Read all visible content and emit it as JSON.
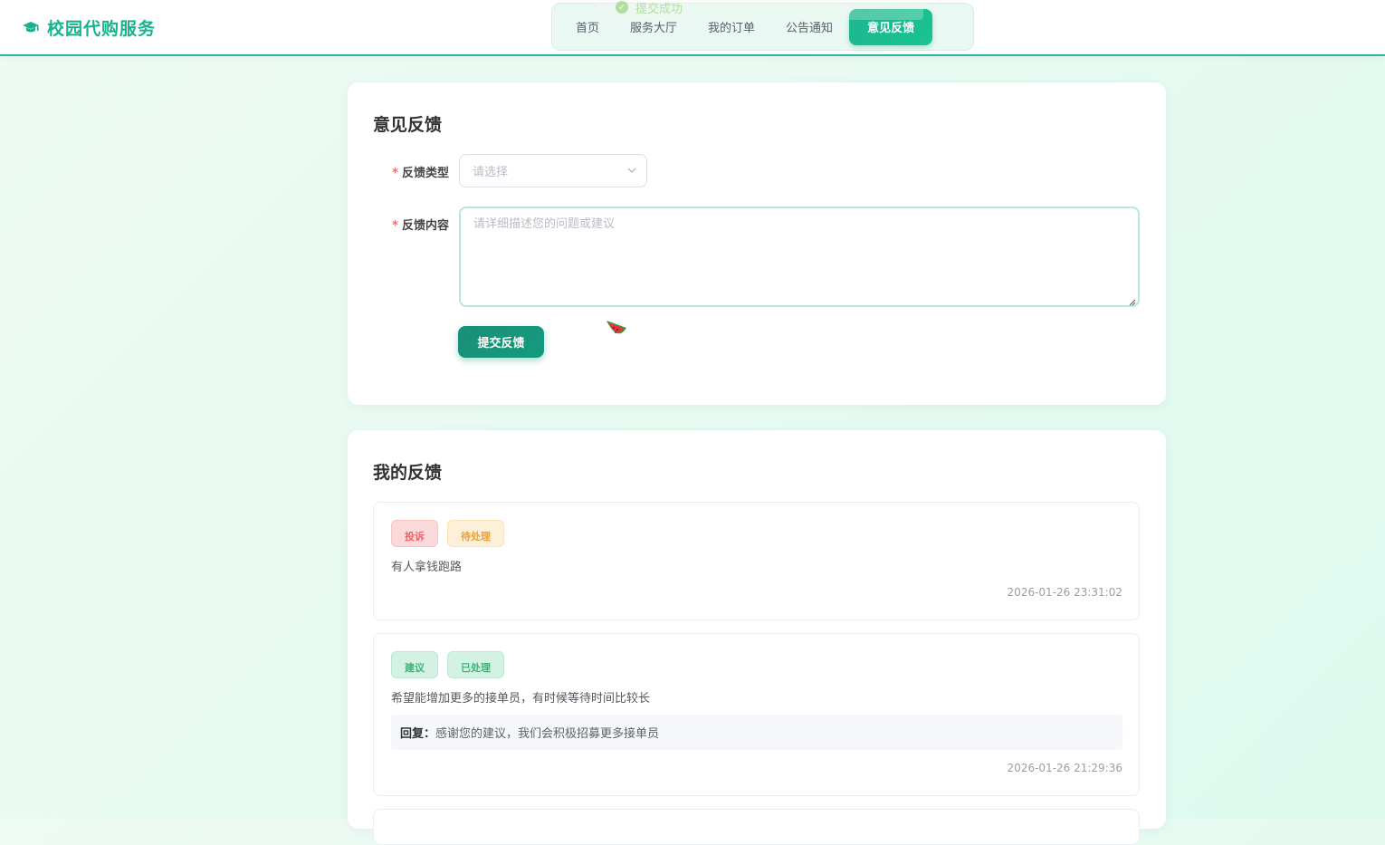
{
  "app": {
    "title": "校园代购服务",
    "accent_color": "#16b38e"
  },
  "toast": {
    "message": "提交成功"
  },
  "nav": {
    "items": [
      {
        "label": "首页"
      },
      {
        "label": "服务大厅"
      },
      {
        "label": "我的订单"
      },
      {
        "label": "公告通知"
      },
      {
        "label": "意见反馈",
        "active": true
      }
    ]
  },
  "feedback_form": {
    "title": "意见反馈",
    "type_label": "反馈类型",
    "type_placeholder": "请选择",
    "content_label": "反馈内容",
    "content_placeholder": "请详细描述您的问题或建议",
    "required_mark": "*",
    "submit_label": "提交反馈"
  },
  "my_feedback": {
    "title": "我的反馈",
    "items": [
      {
        "type_tag": "投诉",
        "status_tag": "待处理",
        "content": "有人拿钱跑路",
        "time": "2026-01-26 23:31:02"
      },
      {
        "type_tag": "建议",
        "status_tag": "已处理",
        "content": "希望能增加更多的接单员，有时候等待时间比较长",
        "reply_label": "回复：",
        "reply": "感谢您的建议，我们会积极招募更多接单员",
        "time": "2026-01-26 21:29:36"
      }
    ]
  }
}
